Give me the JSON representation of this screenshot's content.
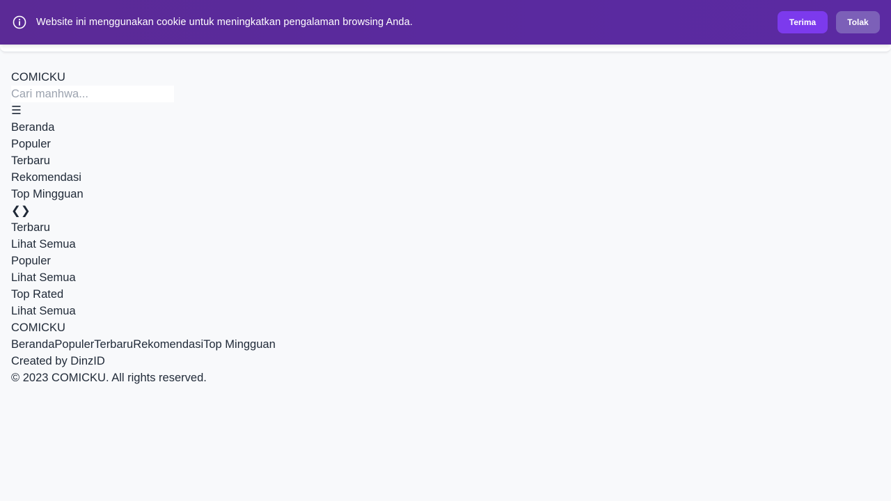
{
  "cookie": {
    "message": "Website ini menggunakan cookie untuk meningkatkan pengalaman browsing Anda.",
    "accept_label": "Terima",
    "reject_label": "Tolak",
    "icon": "info-icon"
  },
  "header": {
    "logo": "COMICKU",
    "search_placeholder": "Cari manhwa...",
    "menu_toggle_glyph": "☰",
    "broken_icon_glyph": "",
    "nav": [
      "Beranda",
      "Populer",
      "Terbaru",
      "Rekomendasi",
      "Top Mingguan"
    ]
  },
  "carousel": {
    "prev_glyph": "❮",
    "next_glyph": "❯"
  },
  "sections": [
    {
      "icon_glyph": "",
      "title": "Terbaru",
      "see_all": "Lihat Semua"
    },
    {
      "icon_glyph": "",
      "title": "Populer",
      "see_all": "Lihat Semua"
    },
    {
      "icon_glyph": "",
      "title": "Top Rated",
      "see_all": "Lihat Semua"
    }
  ],
  "footer": {
    "logo": "COMICKU",
    "links": [
      "Beranda",
      "Populer",
      "Terbaru",
      "Rekomendasi",
      "Top Mingguan"
    ],
    "credit": "Created by DinzID",
    "copyright": "© 2023 COMICKU. All rights reserved."
  },
  "colors": {
    "cookie_bg": "#5a2a9e",
    "accept_bg": "#7c3aed",
    "reject_bg": "#7c60b8",
    "page_bg": "#f8f9fb"
  }
}
